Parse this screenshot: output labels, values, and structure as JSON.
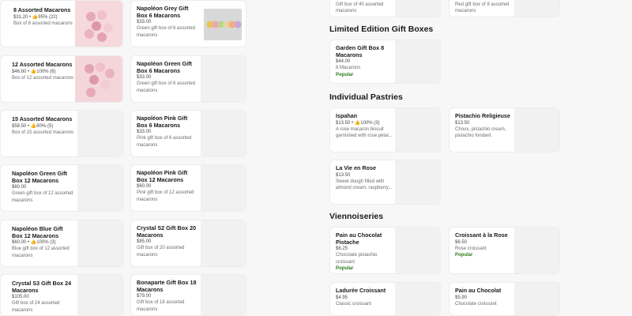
{
  "col1": [
    {
      "title": "8 Assorted Macarons",
      "price": "$31.20",
      "rating": "95% (22)",
      "desc": "Box of 8 assorted macarons"
    },
    {
      "title": "12 Assorted Macarons",
      "price": "$46.80",
      "rating": "100% (6)",
      "desc": "Box of 12 assorted macarons"
    },
    {
      "title": "15 Assorted Macarons",
      "price": "$58.50",
      "rating": "80% (5)",
      "desc": "Box of 15 assorted macarons"
    },
    {
      "title": "Napoléon Green Gift Box 12 Macarons",
      "price": "$60.00",
      "desc": "Green gift box of 12 assorted macarons"
    },
    {
      "title": "Napoléon Blue Gift Box 12 Macarons",
      "price": "$60.00",
      "rating": "100% (3)",
      "desc": "Blue gift box of 12 assorted macarons"
    },
    {
      "title": "Crystal S3 Gift Box 24 Macarons",
      "price": "$105.00",
      "desc": "Gift box of 24 assorted macarons"
    }
  ],
  "col2": [
    {
      "title": "Napoléon Grey Gift Box 6 Macarons",
      "price": "$33.00",
      "desc": "Green gift box of 6 assorted macarons"
    },
    {
      "title": "Napoléon Green Gift Box 6 Macarons",
      "price": "$33.00",
      "desc": "Green gift box of 6 assorted macarons"
    },
    {
      "title": "Napoléon Pink Gift Box 6 Macarons",
      "price": "$33.00",
      "desc": "Pink gift box of 6 assorted macarons"
    },
    {
      "title": "Napoléon Pink Gift Box 12 Macarons",
      "price": "$60.00",
      "desc": "Pink gift box of 12 assorted macarons"
    },
    {
      "title": "Crystal S2 Gift Box 20 Macarons",
      "price": "$85.00",
      "desc": "Gift box of 20 assorted macarons"
    },
    {
      "title": "Bonaparte Gift Box 18 Macarons",
      "price": "$79.00",
      "desc": "Gift box of 18 assorted macarons"
    }
  ],
  "top_partial": {
    "left_desc": "Gift box of 40 assorted macarons",
    "right_desc": "Red gift box of 8 assorted macarons"
  },
  "sections": {
    "limited": "Limited Edition Gift Boxes",
    "pastries": "Individual Pastries",
    "viennoiseries": "Viennoiseries"
  },
  "limited": [
    {
      "title": "Garden Gift Box 8 Macarons",
      "price": "$44.00",
      "desc": "8 Macarons",
      "badge": "Popular"
    }
  ],
  "pastries": [
    {
      "title": "Ispahan",
      "price": "$13.50",
      "rating": "100% (3)",
      "desc": "A rose macaron biscuit garnished with rose petal..."
    },
    {
      "title": "Pistachio Religieuse",
      "price": "$13.50",
      "desc": "Choux, pistachio cream, pistachio fondant"
    },
    {
      "title": "La Vie en Rose",
      "price": "$13.50",
      "desc": "Sweet dough filled with almond cream, raspberry..."
    }
  ],
  "viennoiseries": [
    {
      "title": "Pain au Chocolat Pistache",
      "price": "$6.25",
      "desc": "Chocolate pistachio croissant",
      "badge": "Popular"
    },
    {
      "title": "Croissant à la Rose",
      "price": "$6.50",
      "desc": "Rose croissant",
      "badge": "Popular"
    },
    {
      "title": "Ladurée Croissant",
      "price": "$4.95",
      "desc": "Classic croissant"
    },
    {
      "title": "Pain au Chocolat",
      "price": "$5.90",
      "desc": "Chocolate croissant"
    }
  ],
  "colors": {
    "accent": "#2a7a1a",
    "card": "#ffffff",
    "bg": "#f7f7f7",
    "thumb": "#f1f1f1"
  },
  "icons": {
    "rating": "thumbs-up-icon"
  }
}
